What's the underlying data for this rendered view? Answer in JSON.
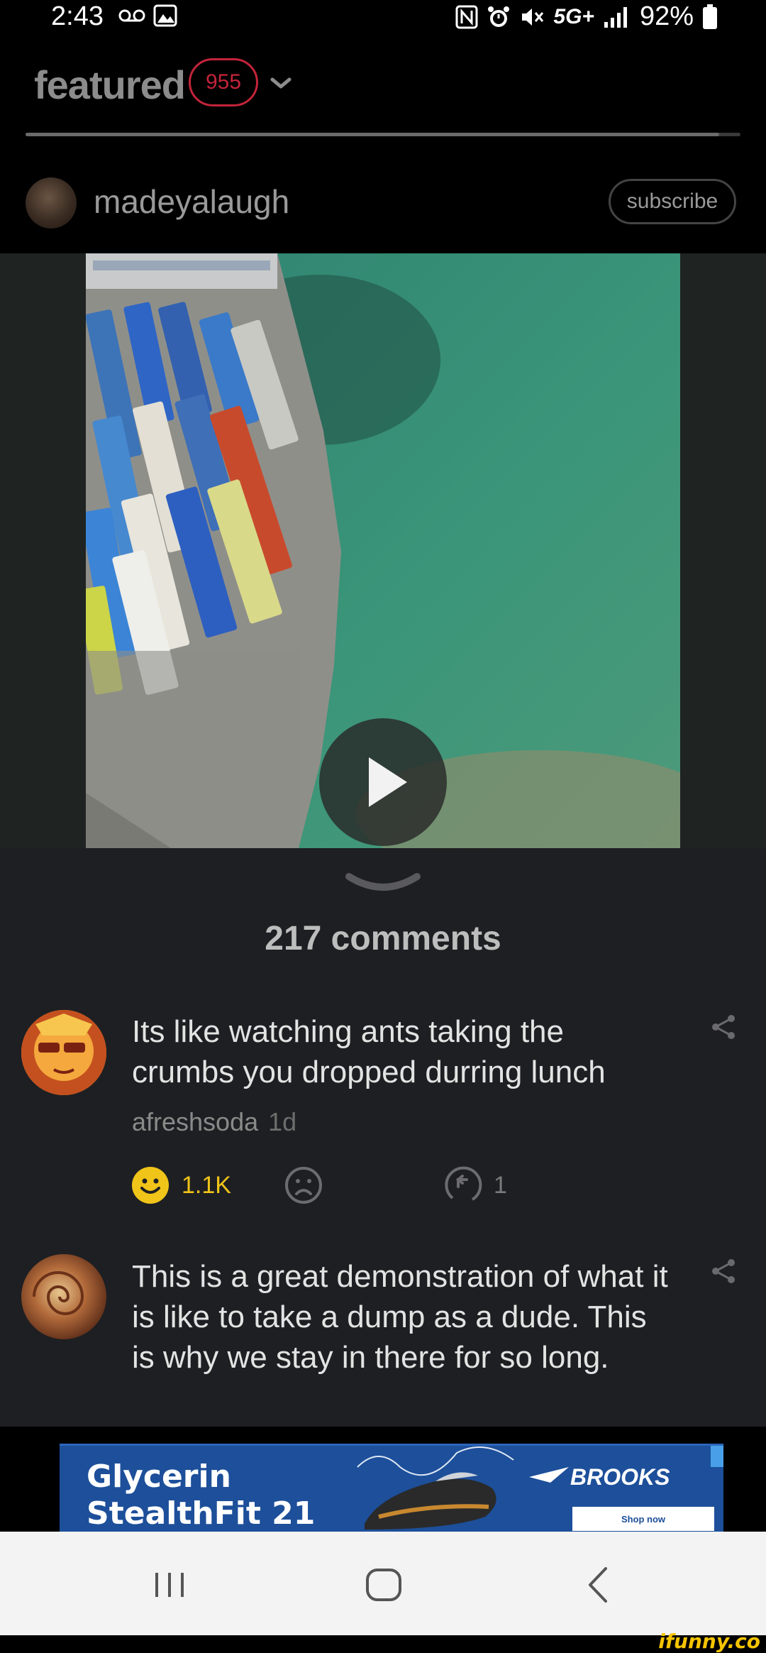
{
  "status_bar": {
    "time": "2:43",
    "battery": "92%",
    "network": "5G+"
  },
  "header": {
    "feed_title": "featured",
    "feed_count": "955",
    "username": "madeyalaugh",
    "subscribe_label": "subscribe"
  },
  "post": {
    "comments_label": "217 comments"
  },
  "comments": [
    {
      "text": "Its like watching ants taking the crumbs you dropped durring lunch",
      "author": "afreshsoda",
      "age": "1d",
      "likes": "1.1K",
      "replies": "1"
    },
    {
      "text": "This is a great demonstration of what it is like to take a dump as a dude. This is why we stay in there for so long."
    }
  ],
  "ad": {
    "headline_line1": "Glycerin",
    "headline_line2": "StealthFit 21",
    "brand": "BROOKS",
    "cta": "Shop now"
  },
  "watermark": "ifunny.co",
  "colors": {
    "accent_red": "#c3243a",
    "like_yellow": "#f0c419",
    "ad_blue": "#1d4f9a"
  }
}
